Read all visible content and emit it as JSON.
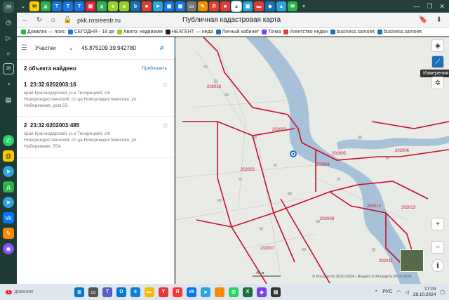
{
  "browser": {
    "url": "pkk.rosreestr.ru",
    "page_title": "Публичная кадастровая карта",
    "tab_count_badge": "28",
    "bookmarks": [
      {
        "label": "Домклик — поис",
        "color": "#2bb24c"
      },
      {
        "label": "СЕГОДНЯ - 18 де",
        "color": "#1a73e8"
      },
      {
        "label": "Авито: недвижим",
        "color": "#97cf26"
      },
      {
        "label": "НЕАГЕНТ — неда",
        "color": "#222222"
      },
      {
        "label": "Личный кабинет",
        "color": "#1b6fb8"
      },
      {
        "label": "Точка",
        "color": "#7b3ff2"
      },
      {
        "label": "Агентство недви",
        "color": "#e53935"
      },
      {
        "label": "business.samolet",
        "color": "#1b6fb8"
      },
      {
        "label": "business.samolet",
        "color": "#1b6fb8"
      }
    ]
  },
  "search": {
    "type": "Участки",
    "query": "45.875109 39.942780"
  },
  "results": {
    "found_text": "2 объекта найдено",
    "zoom_link": "Приблизить",
    "items": [
      {
        "index": "1",
        "number": "23:32:0202003:16",
        "address": "край Краснодарский, р-н Тихорецкий, с/п Новорождественский, ст-ца Новорождественская, ул. Набережная, дом 53"
      },
      {
        "index": "2",
        "number": "23:32:0202003:485",
        "address": "край Краснодарский, р-н Тихорецкий, с/п Новорождественский, ст-ца Новорождественская, ул. Набережная, 55А"
      }
    ]
  },
  "map": {
    "tooltip": "Измерения",
    "attribution": "© Росреестр 2010-2024 | Яндекс © Роскарта 2019-2024",
    "scale_label": "40 м",
    "parcel_labels": [
      "202016",
      "202003",
      "202002",
      "202004",
      "202005",
      "202006",
      "202008",
      "202012",
      "202013",
      "202007",
      "202011"
    ],
    "parcel_color": "#c8102e",
    "water_color": "#a7c2d8"
  },
  "taskbar": {
    "weather": "домклик",
    "lang": "РУС",
    "time": "17:04",
    "date": "28.10.2024",
    "notification_count": "1"
  }
}
